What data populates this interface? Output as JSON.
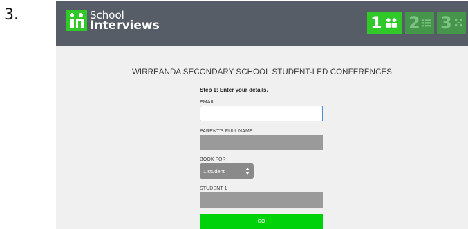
{
  "step_number": "3.",
  "app": {
    "logo_line1": "School",
    "logo_line2": "Interviews"
  },
  "steps": [
    {
      "number": "1",
      "icon": "users-icon",
      "active": true
    },
    {
      "number": "2",
      "icon": "list-icon",
      "active": false
    },
    {
      "number": "3",
      "icon": "clock-icon",
      "active": false
    }
  ],
  "form": {
    "title": "WIRREANDA SECONDARY SCHOOL STUDENT-LED CONFERENCES",
    "instructions": "Step 1: Enter your details.",
    "email_label": "EMAIL",
    "email_value": "",
    "parent_label": "PARENT'S FULL NAME",
    "parent_value": "",
    "book_for_label": "BOOK FOR",
    "book_for_value": "1 student",
    "student1_label": "STUDENT 1",
    "student1_value": "",
    "go_label": "GO"
  },
  "colors": {
    "header_bg": "#565d66",
    "page_bg": "#f0f0f0",
    "accent_green": "#00d20a",
    "step_active": "#31c92a",
    "step_inactive": "#45954a",
    "input_grey": "#9a9a9a",
    "focus_blue": "#4d90d8"
  }
}
